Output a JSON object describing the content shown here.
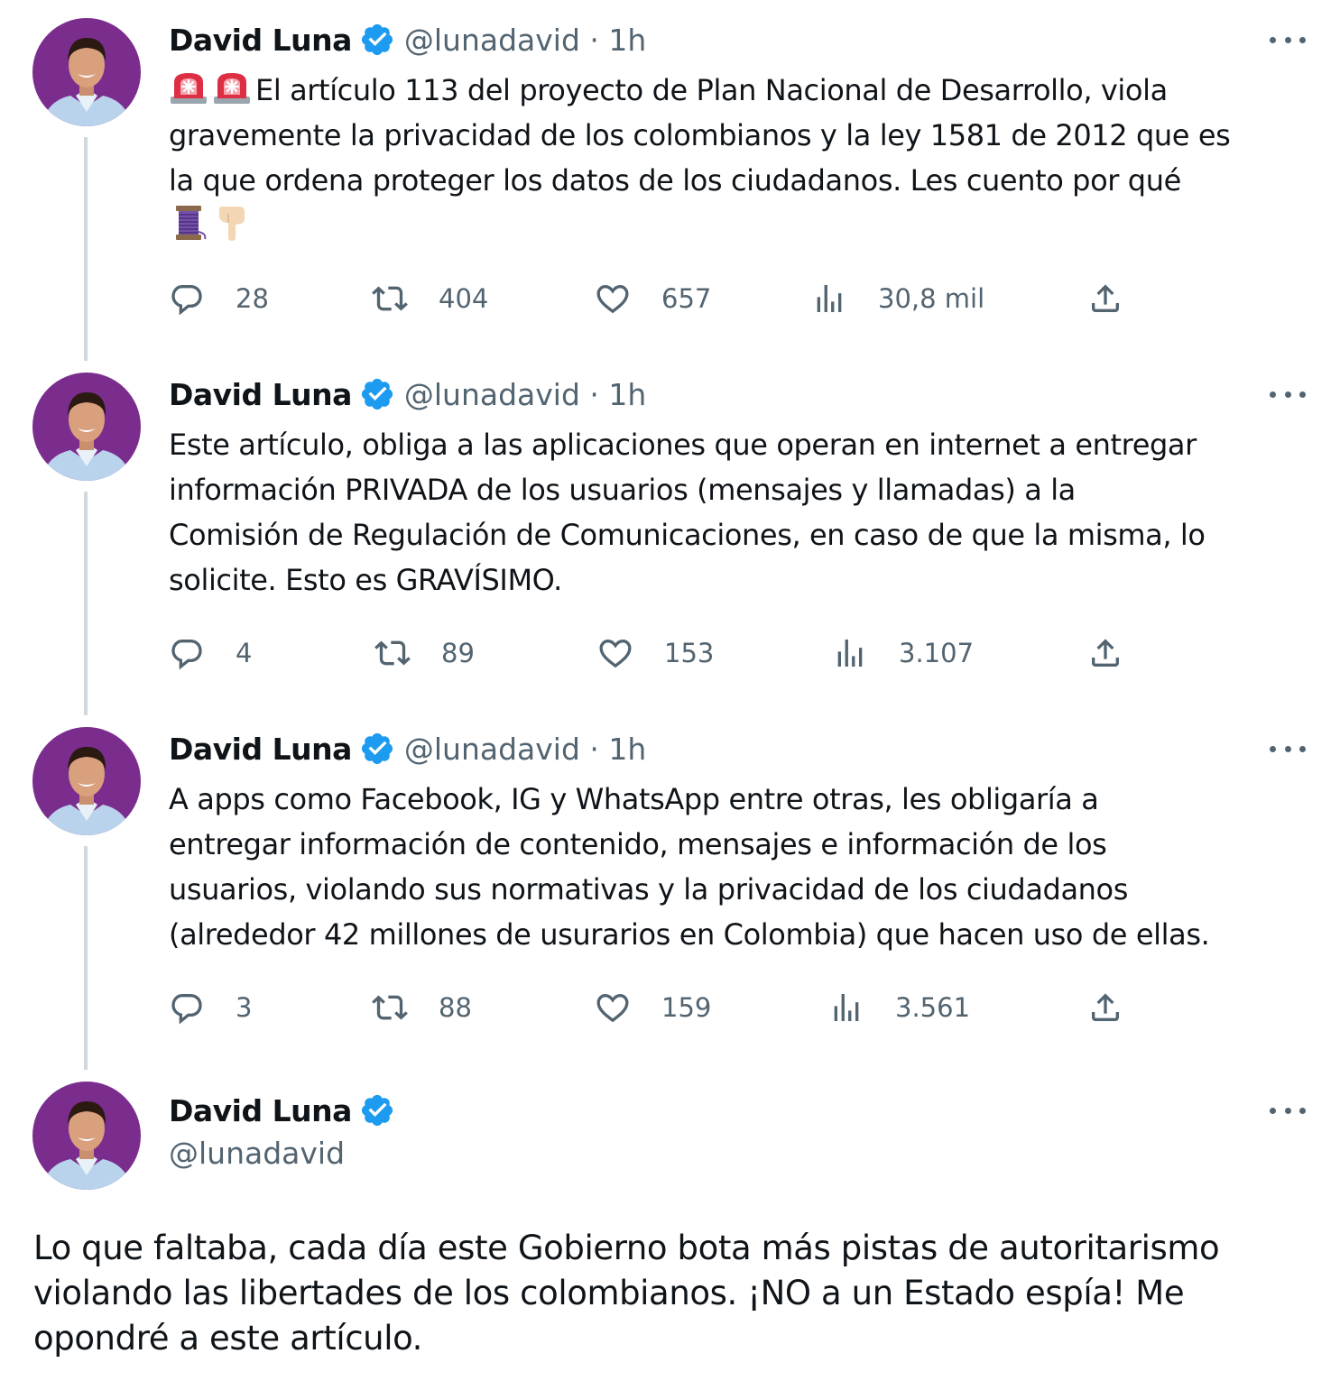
{
  "author": {
    "name": "David Luna",
    "handle": "@lunadavid",
    "verified_color": "#1d9bf0",
    "avatar_bg": "#7b2d8e"
  },
  "thread": [
    {
      "meta": "@lunadavid · 1h",
      "emoji_lead": [
        "police-light-emoji",
        "police-light-emoji"
      ],
      "lines": [
        "El artículo 113 del proyecto de Plan Nacional de Desarrollo, viola",
        "gravemente la privacidad de los colombianos y la ley 1581 de 2012 que es",
        "la que ordena proteger los datos de los ciudadanos. Les cuento por qué"
      ],
      "emoji_trail": [
        "thread-spool-emoji",
        "pointing-down-emoji"
      ],
      "stats": {
        "replies": "28",
        "retweets": "404",
        "likes": "657",
        "views": "30,8 mil"
      }
    },
    {
      "meta": "@lunadavid · 1h",
      "lines": [
        "Este artículo, obliga a las aplicaciones que operan en internet a entregar",
        "información PRIVADA de los usuarios (mensajes y llamadas) a la",
        "Comisión de Regulación de Comunicaciones, en caso de que la misma, lo",
        "solicite. Esto es GRAVÍSIMO."
      ],
      "stats": {
        "replies": "4",
        "retweets": "89",
        "likes": "153",
        "views": "3.107"
      }
    },
    {
      "meta": "@lunadavid · 1h",
      "lines": [
        "A apps como Facebook, IG y WhatsApp entre otras, les obligaría a",
        "entregar información de contenido, mensajes e información de los",
        "usuarios, violando sus normativas y la privacidad de los ciudadanos",
        "(alrededor 42 millones de usurarios en Colombia) que hacen uso de ellas."
      ],
      "stats": {
        "replies": "3",
        "retweets": "88",
        "likes": "159",
        "views": "3.561"
      }
    }
  ],
  "main_tweet": {
    "lines": [
      "Lo que faltaba, cada día este Gobierno bota más pistas de autoritarismo",
      "violando las libertades de los colombianos. ¡NO a un Estado espía! Me",
      "opondré a este artículo."
    ]
  }
}
